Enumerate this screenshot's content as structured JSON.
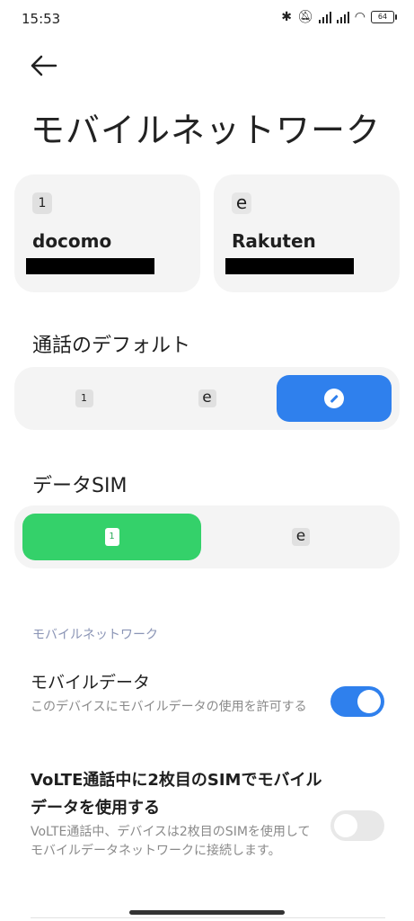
{
  "status_bar": {
    "time": "15:53",
    "battery": "64"
  },
  "header": {
    "title": "モバイルネットワーク"
  },
  "sim_cards": [
    {
      "badge": "1",
      "carrier": "docomo"
    },
    {
      "badge": "e",
      "carrier": "Rakuten"
    }
  ],
  "default_call": {
    "label": "通話のデフォルト",
    "options": [
      {
        "badge": "1",
        "selected": false
      },
      {
        "badge": "e",
        "selected": false
      },
      {
        "icon": "pencil-circle-icon",
        "selected": true
      }
    ]
  },
  "data_sim": {
    "label": "データSIM",
    "options": [
      {
        "badge": "1",
        "selected": true
      },
      {
        "badge": "e",
        "selected": false
      }
    ]
  },
  "mobile_network": {
    "header": "モバイルネットワーク",
    "mobile_data": {
      "title": "モバイルデータ",
      "desc": "このデバイスにモバイルデータの使用を許可する",
      "enabled": true
    },
    "volte_data": {
      "title": "VoLTE通話中に2枚目のSIMでモバイルデータを使用する",
      "desc": "VoLTE通話中、デバイスは2枚目のSIMを使用してモバイルデータネットワークに接続します。",
      "enabled": false
    }
  },
  "colors": {
    "accent": "#2f80ed",
    "data_sim_selected": "#34d16a",
    "card_bg": "#f4f4f4"
  }
}
